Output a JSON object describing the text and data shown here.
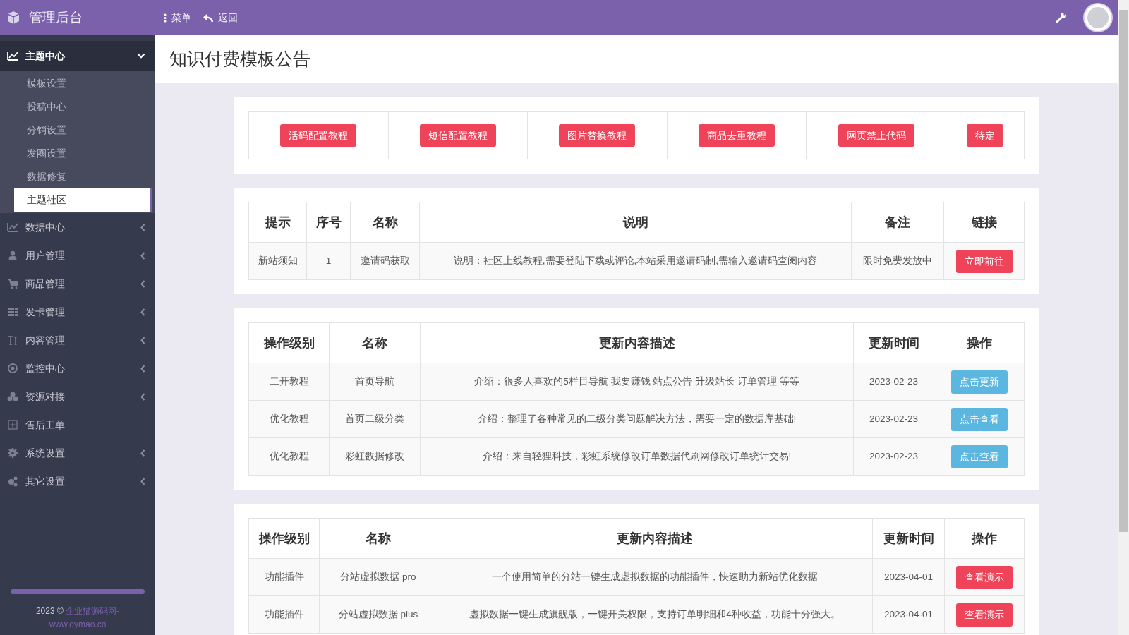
{
  "header": {
    "brand": "管理后台",
    "nav": [
      {
        "kind": "menu",
        "label": "菜单"
      },
      {
        "kind": "back",
        "label": "返回"
      }
    ]
  },
  "sidebar": {
    "items": [
      {
        "label": "主题中心",
        "expanded": true,
        "children": [
          {
            "label": "模板设置",
            "selected": false
          },
          {
            "label": "投稿中心",
            "selected": false
          },
          {
            "label": "分销设置",
            "selected": false
          },
          {
            "label": "发圈设置",
            "selected": false
          },
          {
            "label": "数据修复",
            "selected": false
          },
          {
            "label": "主题社区",
            "selected": true
          }
        ]
      },
      {
        "label": "数据中心",
        "expanded": false
      },
      {
        "label": "用户管理",
        "expanded": false
      },
      {
        "label": "商品管理",
        "expanded": false
      },
      {
        "label": "发卡管理",
        "expanded": false
      },
      {
        "label": "内容管理",
        "expanded": false
      },
      {
        "label": "监控中心",
        "expanded": false
      },
      {
        "label": "资源对接",
        "expanded": false
      },
      {
        "label": "售后工单"
      },
      {
        "label": "系统设置",
        "expanded": false
      },
      {
        "label": "其它设置",
        "expanded": false
      }
    ],
    "footer": {
      "year": "2023 ©",
      "links": [
        "企业猫源码网-",
        "www.qymao.cn"
      ]
    }
  },
  "page_title": "知识付费模板公告",
  "tutorial_buttons": [
    "活码配置教程",
    "短信配置教程",
    "图片替换教程",
    "商品去重教程",
    "网页禁止代码",
    "待定"
  ],
  "tables": [
    {
      "columns": [
        "提示",
        "序号",
        "名称",
        "说明",
        "备注",
        "链接"
      ],
      "rows": [
        {
          "cells": [
            "新站须知",
            "1",
            "邀请码获取",
            "说明：社区上线教程,需要登陆下载或评论,本站采用邀请码制,需输入邀请码查阅内容",
            "限时免费发放中"
          ],
          "action": {
            "label": "立即前往",
            "kind": "danger"
          }
        }
      ]
    },
    {
      "columns": [
        "操作级别",
        "名称",
        "更新内容描述",
        "更新时间",
        "操作"
      ],
      "rows": [
        {
          "cells": [
            "二开教程",
            "首页导航",
            "介绍：很多人喜欢的5栏目导航 我要赚钱 站点公告 升级站长 订单管理 等等",
            "2023-02-23"
          ],
          "action": {
            "label": "点击更新",
            "kind": "info"
          }
        },
        {
          "cells": [
            "优化教程",
            "首页二级分类",
            "介绍：整理了各种常见的二级分类问题解决方法，需要一定的数据库基础!",
            "2023-02-23"
          ],
          "action": {
            "label": "点击查看",
            "kind": "info"
          }
        },
        {
          "cells": [
            "优化教程",
            "彩虹数据修改",
            "介绍：来自轻狸科技，彩虹系统修改订单数据代刷网修改订单统计交易!",
            "2023-02-23"
          ],
          "action": {
            "label": "点击查看",
            "kind": "info"
          }
        }
      ]
    },
    {
      "columns": [
        "操作级别",
        "名称",
        "更新内容描述",
        "更新时间",
        "操作"
      ],
      "rows": [
        {
          "cells": [
            "功能插件",
            "分站虚拟数据 pro",
            "一个使用简单的分站一键生成虚拟数据的功能插件，快速助力新站优化数据",
            "2023-04-01"
          ],
          "action": {
            "label": "查看演示",
            "kind": "danger"
          }
        },
        {
          "cells": [
            "功能插件",
            "分站虚拟数据 plus",
            "虚拟数据一键生成旗舰版，一键开关权限，支持订单明细和4种收益，功能十分强大。",
            "2023-04-01"
          ],
          "action": {
            "label": "查看演示",
            "kind": "danger"
          }
        }
      ]
    }
  ]
}
